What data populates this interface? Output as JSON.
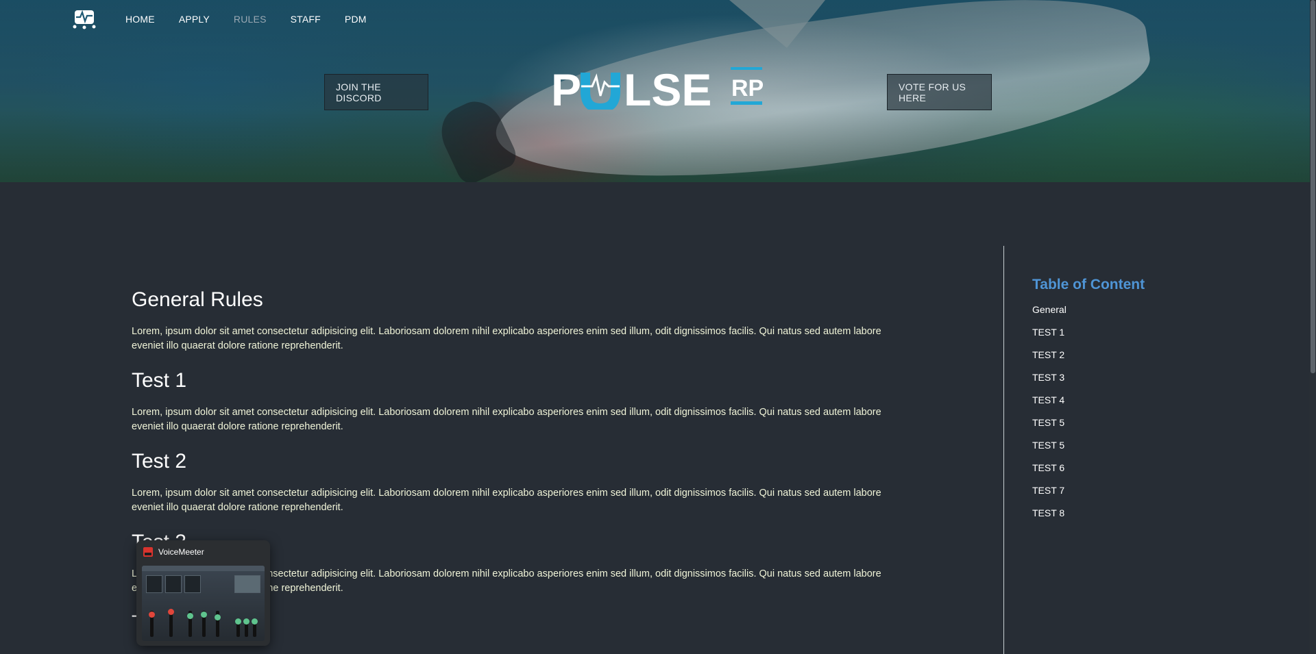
{
  "nav": {
    "items": [
      {
        "label": "HOME"
      },
      {
        "label": "APPLY"
      },
      {
        "label": "RULES",
        "active": true
      },
      {
        "label": "STAFF"
      },
      {
        "label": "PDM"
      }
    ]
  },
  "hero": {
    "discord_button": "JOIN THE DISCORD",
    "vote_button": "VOTE FOR US HERE",
    "brand_name": "PULSE",
    "brand_suffix": "RP"
  },
  "sections": [
    {
      "heading": "General Rules",
      "body": "Lorem, ipsum dolor sit amet consectetur adipisicing elit. Laboriosam dolorem nihil explicabo asperiores enim sed illum, odit dignissimos facilis. Qui natus sed autem labore eveniet illo quaerat dolore ratione reprehenderit."
    },
    {
      "heading": "Test 1",
      "body": "Lorem, ipsum dolor sit amet consectetur adipisicing elit. Laboriosam dolorem nihil explicabo asperiores enim sed illum, odit dignissimos facilis. Qui natus sed autem labore eveniet illo quaerat dolore ratione reprehenderit."
    },
    {
      "heading": "Test 2",
      "body": "Lorem, ipsum dolor sit amet consectetur adipisicing elit. Laboriosam dolorem nihil explicabo asperiores enim sed illum, odit dignissimos facilis. Qui natus sed autem labore eveniet illo quaerat dolore ratione reprehenderit."
    },
    {
      "heading": "Test 3",
      "body": "Lorem, ipsum dolor sit amet consectetur adipisicing elit. Laboriosam dolorem nihil explicabo asperiores enim sed illum, odit dignissimos facilis. Qui natus sed autem labore eveniet illo quaerat dolore ratione reprehenderit."
    },
    {
      "heading": "Test 4",
      "body": ""
    }
  ],
  "toc": {
    "title": "Table of Content",
    "items": [
      "General",
      "TEST 1",
      "TEST 2",
      "TEST 3",
      "TEST 4",
      "TEST 5",
      "TEST 5",
      "TEST 6",
      "TEST 7",
      "TEST 8"
    ]
  },
  "taskbar_preview": {
    "app_name": "VoiceMeeter"
  },
  "colors": {
    "page_bg": "#272d35",
    "accent_blue": "#4f95d6",
    "brand_cyan": "#22a7d6",
    "nav_active": "#9aa8b3"
  }
}
